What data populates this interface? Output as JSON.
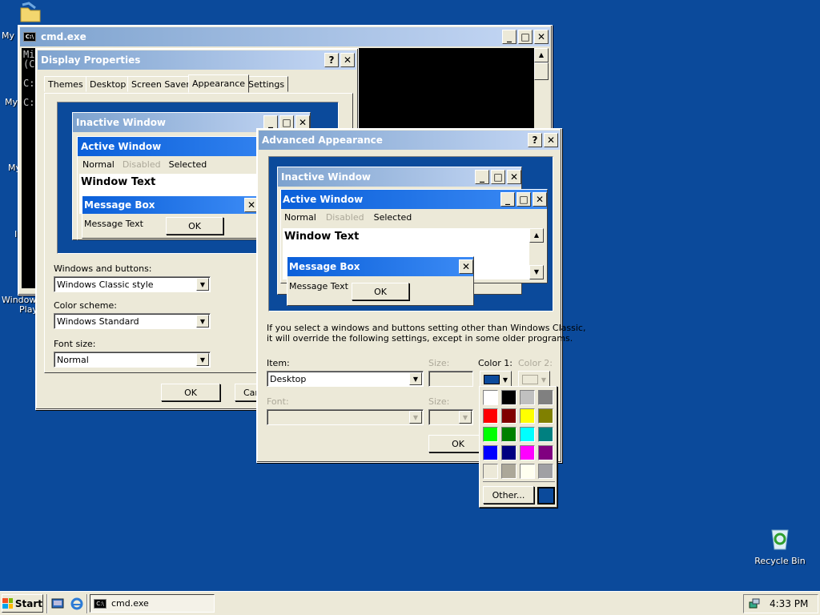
{
  "desktop": {
    "icons": [
      {
        "label": "My"
      },
      {
        "label": "My"
      },
      {
        "label": "My"
      },
      {
        "label": "I"
      },
      {
        "label": "Windows"
      },
      {
        "label": "Play"
      }
    ],
    "recycle_bin": "Recycle Bin"
  },
  "cmd": {
    "title": "cmd.exe",
    "lines": [
      "Mi",
      "(C",
      "",
      "C:",
      "",
      "C:"
    ]
  },
  "display_props": {
    "title": "Display Properties",
    "tabs": [
      "Themes",
      "Desktop",
      "Screen Saver",
      "Appearance",
      "Settings"
    ],
    "selected_tab": "Appearance",
    "preview": {
      "inactive": "Inactive Window",
      "active": "Active Window",
      "normal": "Normal",
      "disabled": "Disabled",
      "selected": "Selected",
      "window_text": "Window Text",
      "message_box": "Message Box",
      "message_text": "Message Text",
      "ok": "OK"
    },
    "windows_buttons_label": "Windows and buttons:",
    "windows_buttons_value": "Windows Classic style",
    "color_scheme_label": "Color scheme:",
    "color_scheme_value": "Windows Standard",
    "font_size_label": "Font size:",
    "font_size_value": "Normal",
    "ok_label": "OK",
    "cancel_label": "Can"
  },
  "advanced": {
    "title": "Advanced Appearance",
    "preview": {
      "inactive": "Inactive Window",
      "active": "Active Window",
      "normal": "Normal",
      "disabled": "Disabled",
      "selected": "Selected",
      "window_text": "Window Text",
      "message_box": "Message Box",
      "message_text": "Message Text",
      "ok": "OK"
    },
    "info_text_line1": "If you select a windows and buttons setting other than Windows Classic,",
    "info_text_line2": "it will override the following settings, except in some older programs.",
    "item_label": "Item:",
    "item_value": "Desktop",
    "size_label": "Size:",
    "color1_label": "Color 1:",
    "color2_label": "Color 2:",
    "font_label": "Font:",
    "size2_label": "Size:",
    "ok_label": "OK",
    "color1_value": "#0B4A9B"
  },
  "palette": {
    "colors": [
      "#FFFFFF",
      "#000000",
      "#C0C0C0",
      "#808080",
      "#FF0000",
      "#800000",
      "#FFFF00",
      "#808000",
      "#00FF00",
      "#008000",
      "#00FFFF",
      "#008080",
      "#0000FF",
      "#000080",
      "#FF00FF",
      "#800080",
      "#ECE9D8",
      "#ACA899",
      "#FFFFF0",
      "#A0A0A4"
    ],
    "other_label": "Other...",
    "current": "#0B4A9B"
  },
  "taskbar": {
    "start_label": "Start",
    "task_cmd": "cmd.exe",
    "clock": "4:33 PM"
  }
}
